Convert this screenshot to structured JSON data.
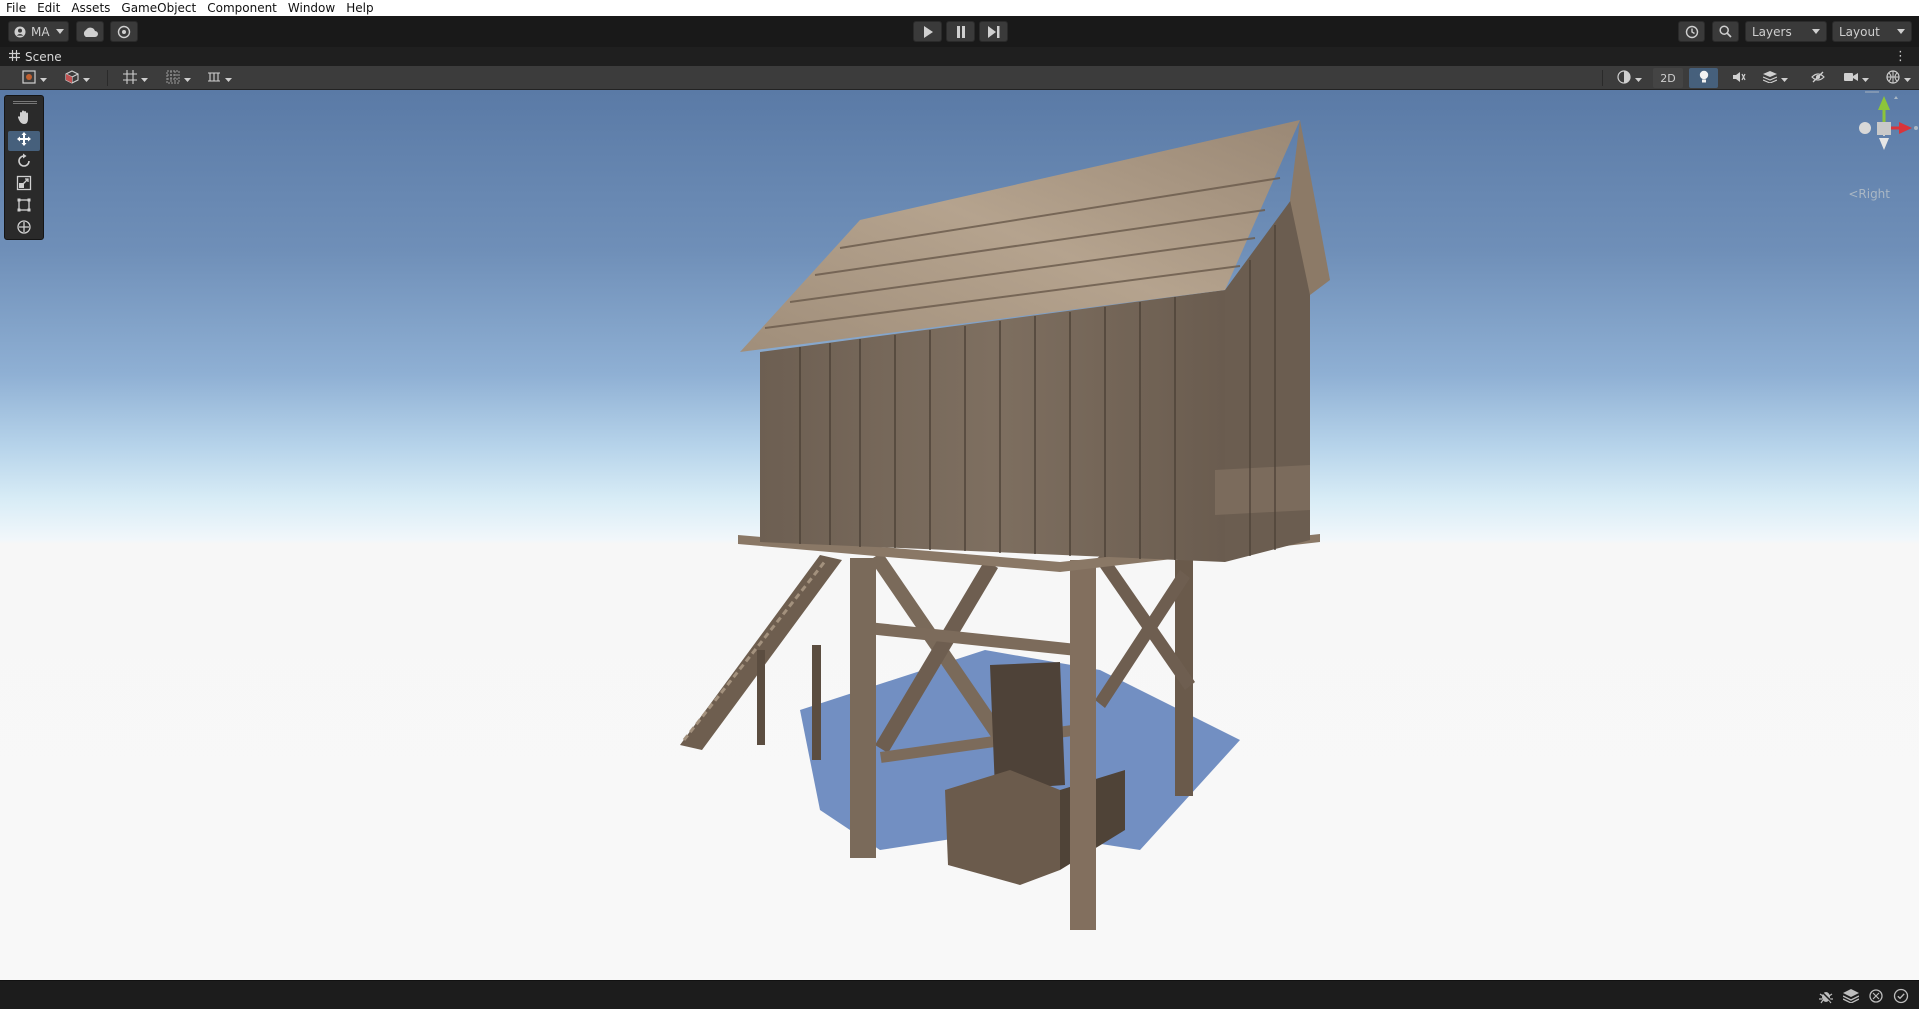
{
  "menu": [
    "File",
    "Edit",
    "Assets",
    "GameObject",
    "Component",
    "Window",
    "Help"
  ],
  "toolbar": {
    "account_label": "MA",
    "layers_label": "Layers",
    "layout_label": "Layout"
  },
  "scene_tab": {
    "label": "Scene"
  },
  "scene_toolbar": {
    "two_d_label": "2D"
  },
  "gizmo": {
    "view_label": "Right"
  },
  "colors": {
    "accent_selected": "#46607c",
    "sky_top": "#5a7aa6",
    "horizon": "#f1f7fb",
    "ground": "#f8f8f8",
    "wood": "#8a7865",
    "axis_y": "#8cc43a",
    "axis_x": "#d9343a"
  }
}
